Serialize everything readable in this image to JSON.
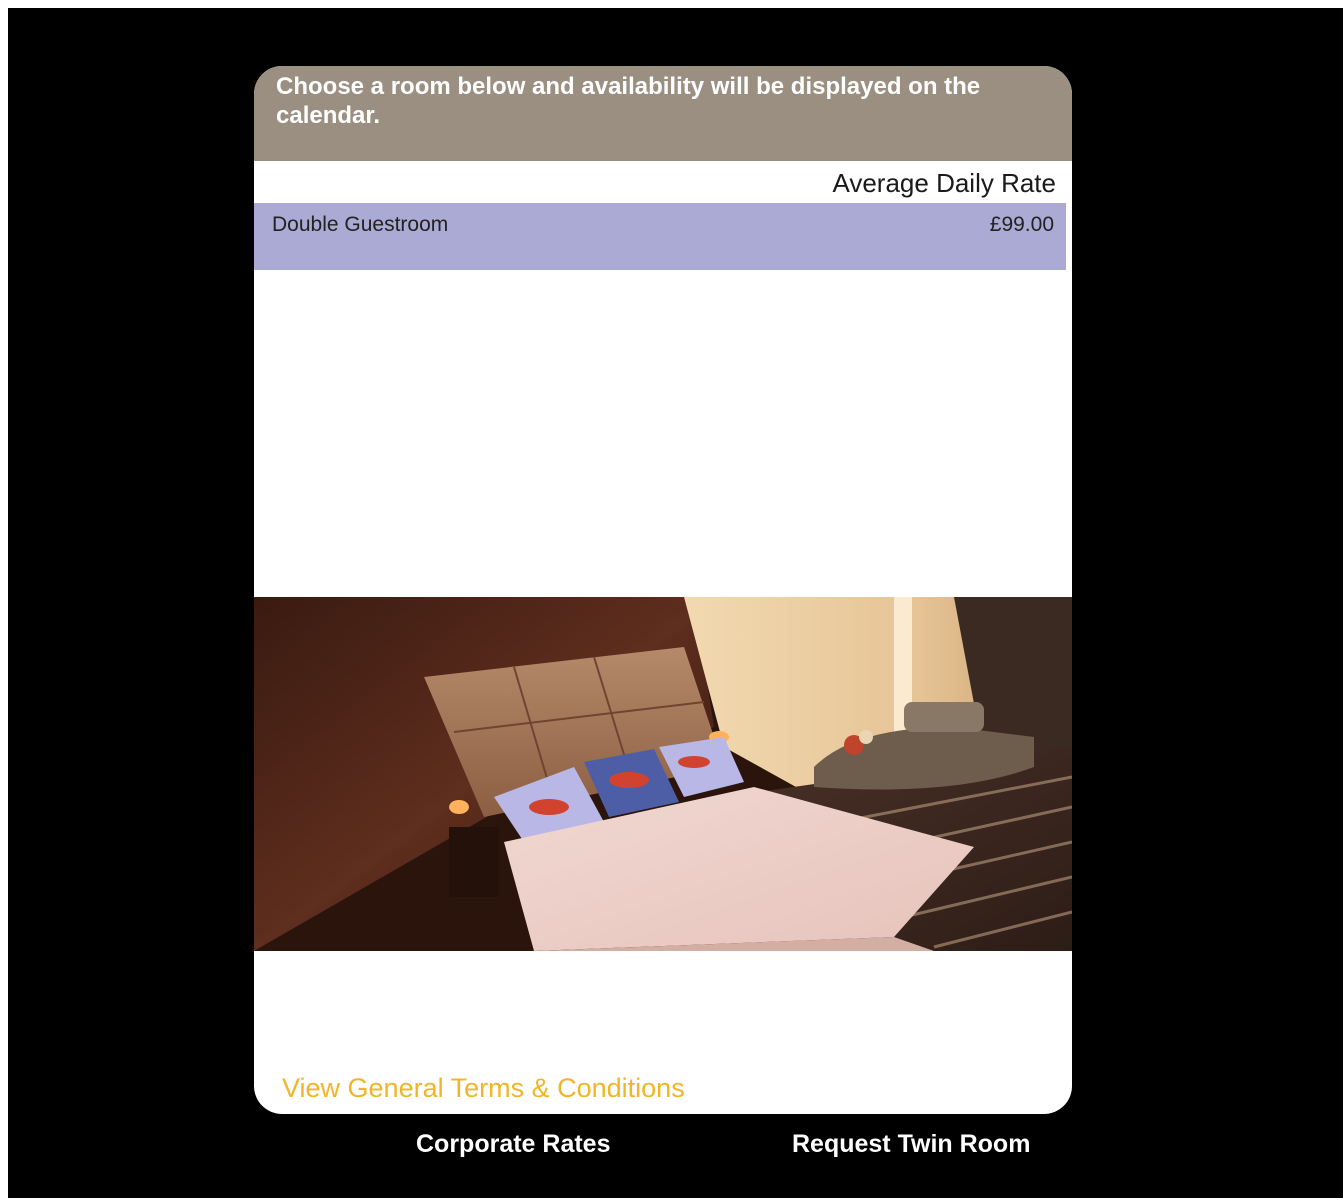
{
  "instructions": {
    "text": "Choose a room below and availability will be displayed on the calendar."
  },
  "rates": {
    "column_header": "Average Daily Rate",
    "rooms": [
      {
        "name": "Double Guestroom",
        "price": "£99.00"
      }
    ]
  },
  "photo": {
    "subject": "hotel-bedroom-photo"
  },
  "links": {
    "terms": "View General Terms & Conditions",
    "corporate_rates": "Corporate Rates",
    "request_twin_room": "Request Twin Room"
  },
  "colors": {
    "background": "#000000",
    "header_band": "#9b8f82",
    "selected_row": "#abaad4",
    "terms_link": "#f3b428",
    "bottom_links": "#ffffff"
  }
}
